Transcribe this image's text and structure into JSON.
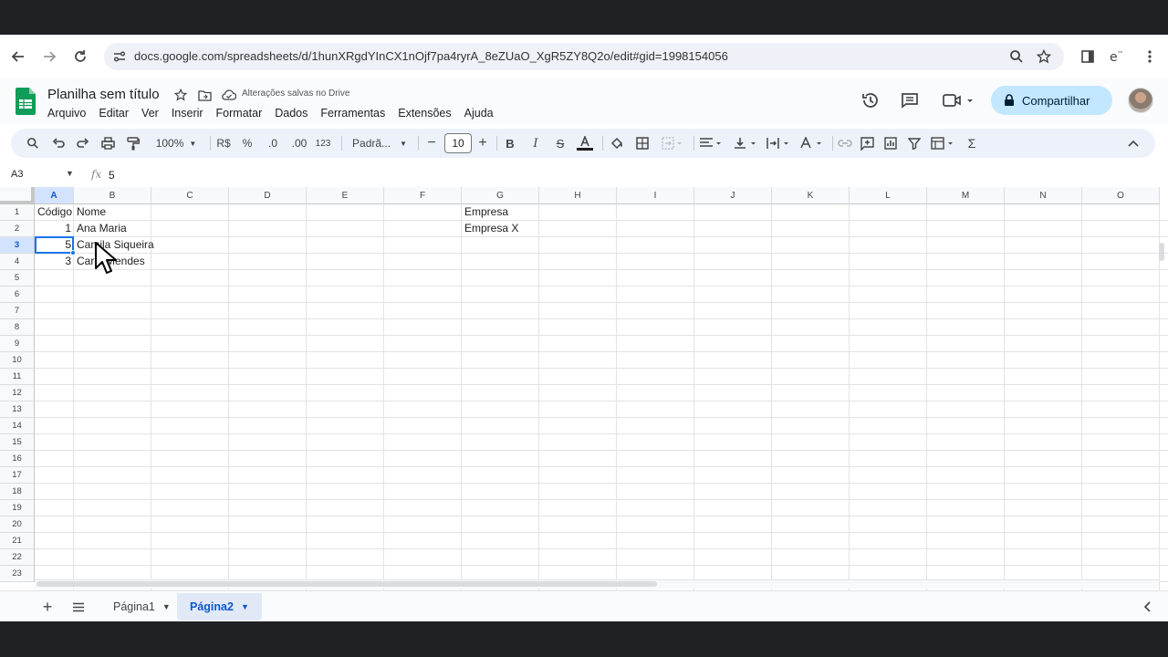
{
  "browser": {
    "url": "docs.google.com/spreadsheets/d/1hunXRgdYInCX1nOjf7pa4ryrA_8eZUaO_XgR5ZY8Q2o/edit#gid=1998154056"
  },
  "doc": {
    "title": "Planilha sem título",
    "saved_status": "Alterações salvas no Drive",
    "menu": [
      "Arquivo",
      "Editar",
      "Ver",
      "Inserir",
      "Formatar",
      "Dados",
      "Ferramentas",
      "Extensões",
      "Ajuda"
    ],
    "share_label": "Compartilhar"
  },
  "toolbar": {
    "zoom": "100%",
    "currency": "R$",
    "percent": "%",
    "dec_decrease": ".0",
    "dec_increase": ".00",
    "format_123": "123",
    "font": "Padrã...",
    "font_size": "10"
  },
  "formula_bar": {
    "cell_ref": "A3",
    "fx": "fx",
    "value": "5"
  },
  "grid": {
    "columns": [
      "A",
      "B",
      "C",
      "D",
      "E",
      "F",
      "G",
      "H",
      "I",
      "J",
      "K",
      "L",
      "M",
      "N",
      "O"
    ],
    "rows": [
      "1",
      "2",
      "3",
      "4",
      "5",
      "6",
      "7",
      "8",
      "9",
      "10",
      "11",
      "12",
      "13",
      "14",
      "15",
      "16",
      "17",
      "18",
      "19",
      "20",
      "21",
      "22",
      "23"
    ],
    "cells": {
      "A1": "Código",
      "B1": "Nome",
      "G1": "Empresa",
      "A2": "1",
      "B2": "Ana Maria",
      "G2": "Empresa X",
      "A3": "5",
      "B3": "Camila Siqueira",
      "A4": "3",
      "B4": "Carla Mendes"
    }
  },
  "sheets": {
    "tabs": [
      {
        "label": "Página1",
        "active": false
      },
      {
        "label": "Página2",
        "active": true
      }
    ]
  },
  "colors": {
    "accent": "#0b57d0",
    "share_bg": "#c2e7ff",
    "selection": "#1a73e8",
    "sheets_green": "#0f9d58"
  }
}
